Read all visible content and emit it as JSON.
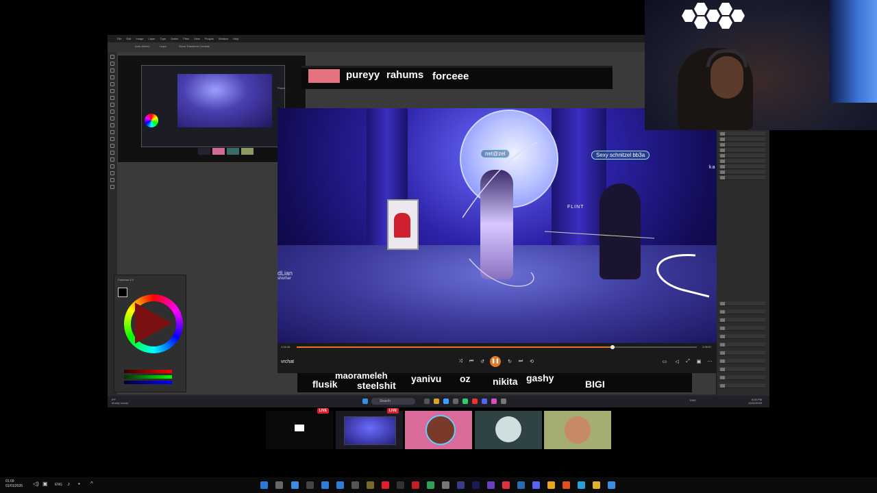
{
  "photoshop": {
    "menu": [
      "File",
      "Edit",
      "Image",
      "Layer",
      "Type",
      "Select",
      "Filter",
      "View",
      "Plugins",
      "Window",
      "Help"
    ],
    "options": {
      "auto_select": "Auto-Select:",
      "layer": "Layer",
      "show_transform": "Show Transform Controls"
    },
    "color_panel_title": "Coolorus 2.5",
    "user_status": [
      "IFF",
      "Mostly cloudy"
    ]
  },
  "player": {
    "header": "Player",
    "video_title": "vrchat",
    "time_current": "1:16:26",
    "time_total": "2:08:57",
    "progress": 0.79,
    "nametags": {
      "main": "net@zel",
      "secondary": "Sexy schnitzel bb3a",
      "flint": "FLINT",
      "side": "ka"
    },
    "handwriting": [
      "dLian",
      "she/her"
    ]
  },
  "chat_top": {
    "users": [
      "pureyy",
      "rahums",
      "forceee"
    ]
  },
  "chat_bottom": {
    "users": [
      "maorameleh",
      "flusik",
      "steelshit",
      "yanivu",
      "oz",
      "nikita",
      "gashy",
      "BIGI"
    ]
  },
  "inner_taskbar": {
    "search": "Search",
    "tray": "ENG",
    "clock_time": "8:00 PM",
    "clock_date": "12/01/2025"
  },
  "tiles": {
    "live_badge": "LIVE"
  },
  "host_taskbar": {
    "time": "01:09",
    "date": "01/01/2026"
  },
  "colors": {
    "accent_orange": "#e07a2a",
    "live_red": "#e0202e",
    "pink_tile": "#e4737f",
    "vr_blue": "#2c22a8"
  }
}
